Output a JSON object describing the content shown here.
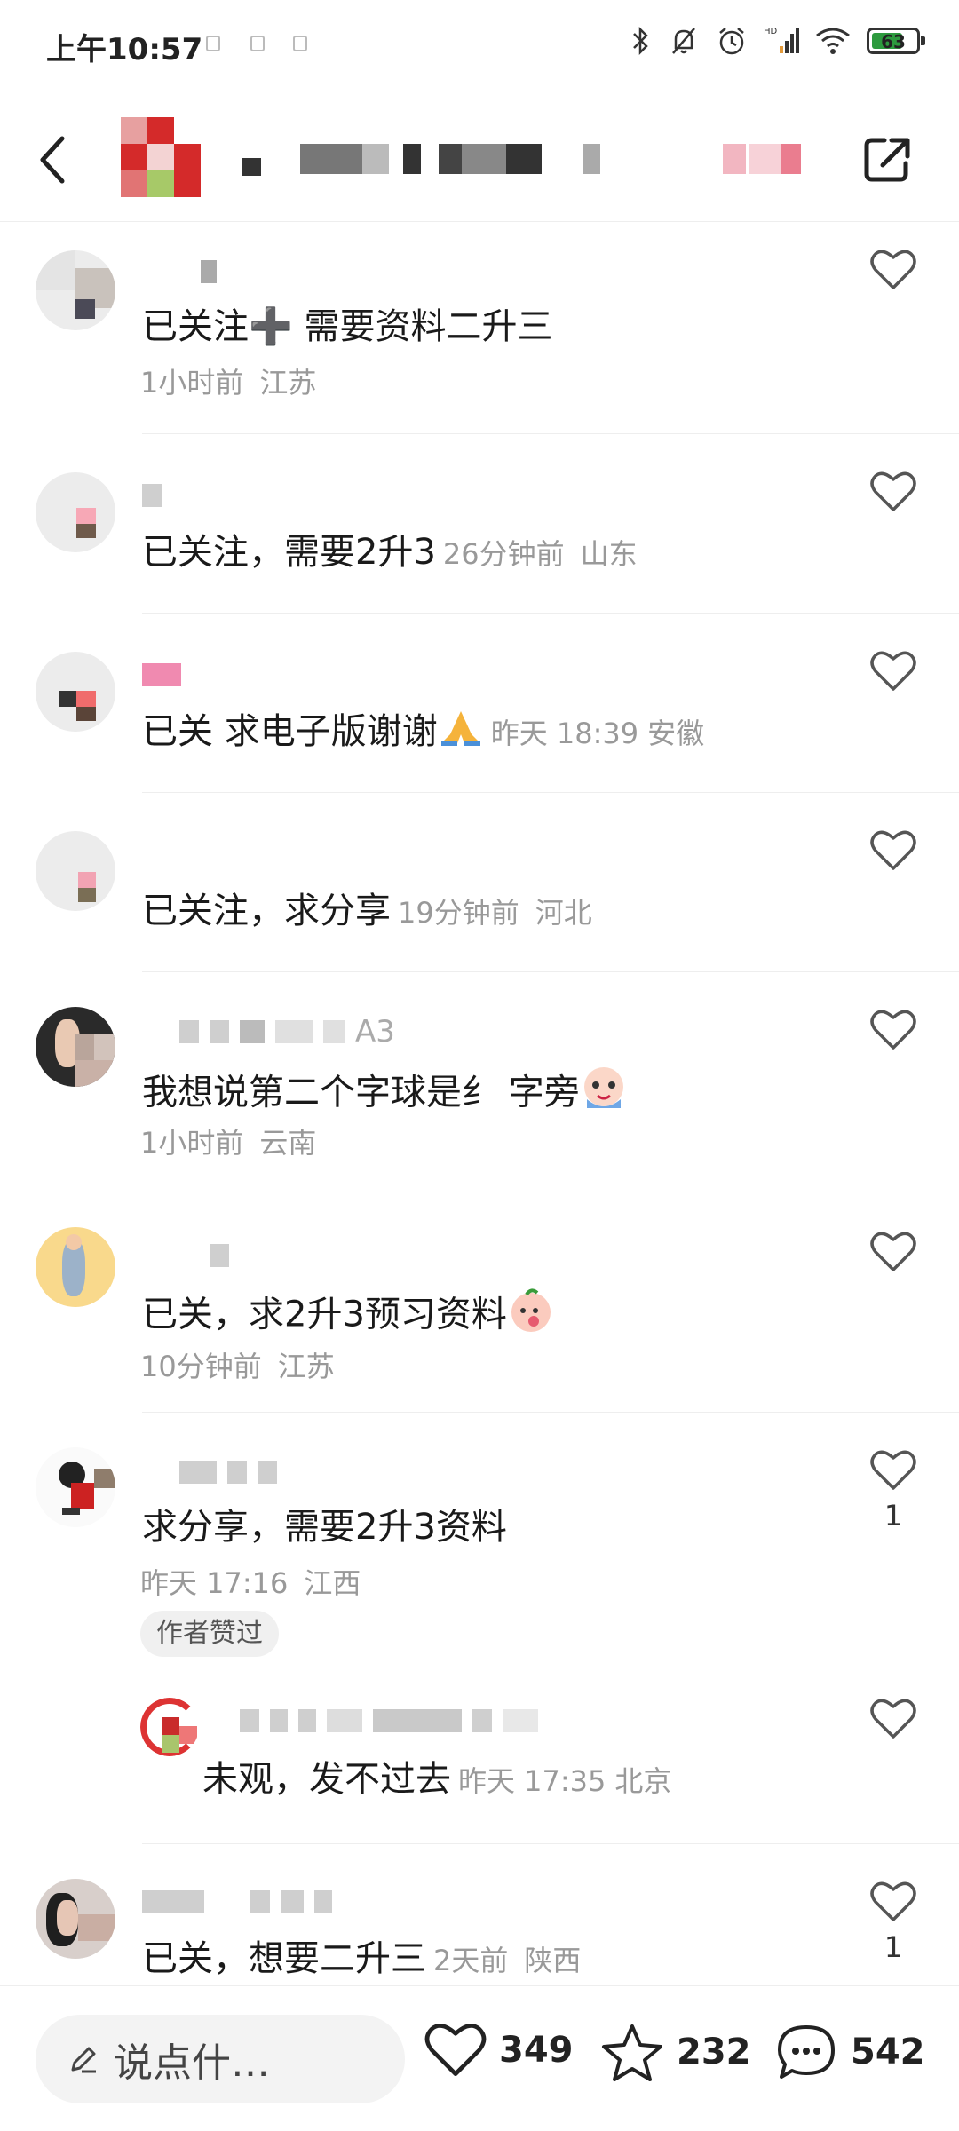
{
  "status_bar": {
    "time": "上午10:57",
    "battery": "63"
  },
  "comments": [
    {
      "text": "已关注➕ 需要资料二升三",
      "time": "1小时前",
      "location": "江苏"
    },
    {
      "text": "已关注，需要2升3",
      "time": "26分钟前",
      "location": "山东"
    },
    {
      "text": "已关 求电子版谢谢",
      "time": "昨天 18:39",
      "location": "安徽"
    },
    {
      "text": "已关注，求分享",
      "time": "19分钟前",
      "location": "河北"
    },
    {
      "username_tail": "A3",
      "text": "我想说第二个字球是纟 字旁",
      "time": "1小时前",
      "location": "云南"
    },
    {
      "text": "已关，求2升3预习资料",
      "time": "10分钟前",
      "location": "江苏"
    },
    {
      "text": "求分享，需要2升3资料",
      "time": "昨天 17:16",
      "location": "江西",
      "likes": "1",
      "badge": "作者赞过"
    },
    {
      "text": "未观，发不过去",
      "time": "昨天 17:35",
      "location": "北京"
    },
    {
      "text": "已关，想要二升三",
      "time": "2天前",
      "location": "陕西",
      "likes": "1"
    }
  ],
  "bottom_bar": {
    "input_placeholder": "说点什…",
    "likes": "349",
    "favorites": "232",
    "comments": "542"
  },
  "colors": {
    "text": "#1a1a1a",
    "meta": "#999999",
    "badge_bg": "#f0f0f0"
  }
}
